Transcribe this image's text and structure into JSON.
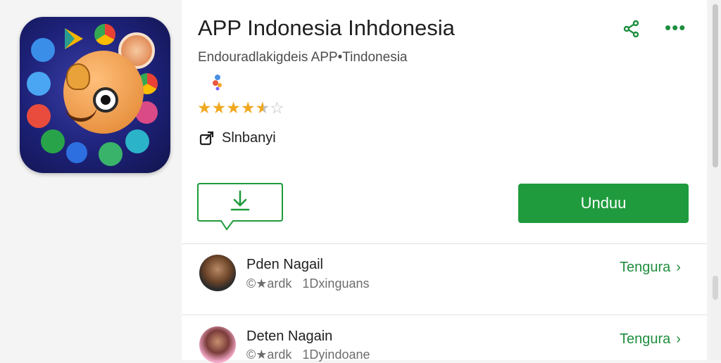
{
  "app": {
    "title": "APP Indonesia Inhdonesia",
    "developer": "Endouradlakigdeis APP•Tindonesia",
    "rating": 4.5,
    "rating_stars": [
      "★",
      "★",
      "★",
      "★"
    ],
    "rating_half": "★",
    "rating_empty": "☆",
    "share_label": "Slnbanyi",
    "install_label": "Unduu",
    "accent_color": "#1f9b3d"
  },
  "header": {
    "more_glyph": "•••"
  },
  "list": [
    {
      "name": "Pden Nagail",
      "meta_glyph": "©",
      "meta_star": "★",
      "meta": "ardk   1Dxinguans",
      "follow_label": "Tengura",
      "chevron": "›"
    },
    {
      "name": "Deten Nagain",
      "meta_glyph": "©",
      "meta_star": "★",
      "meta": "ardk   1Dyindoane",
      "follow_label": "Tengura",
      "chevron": "›"
    }
  ]
}
